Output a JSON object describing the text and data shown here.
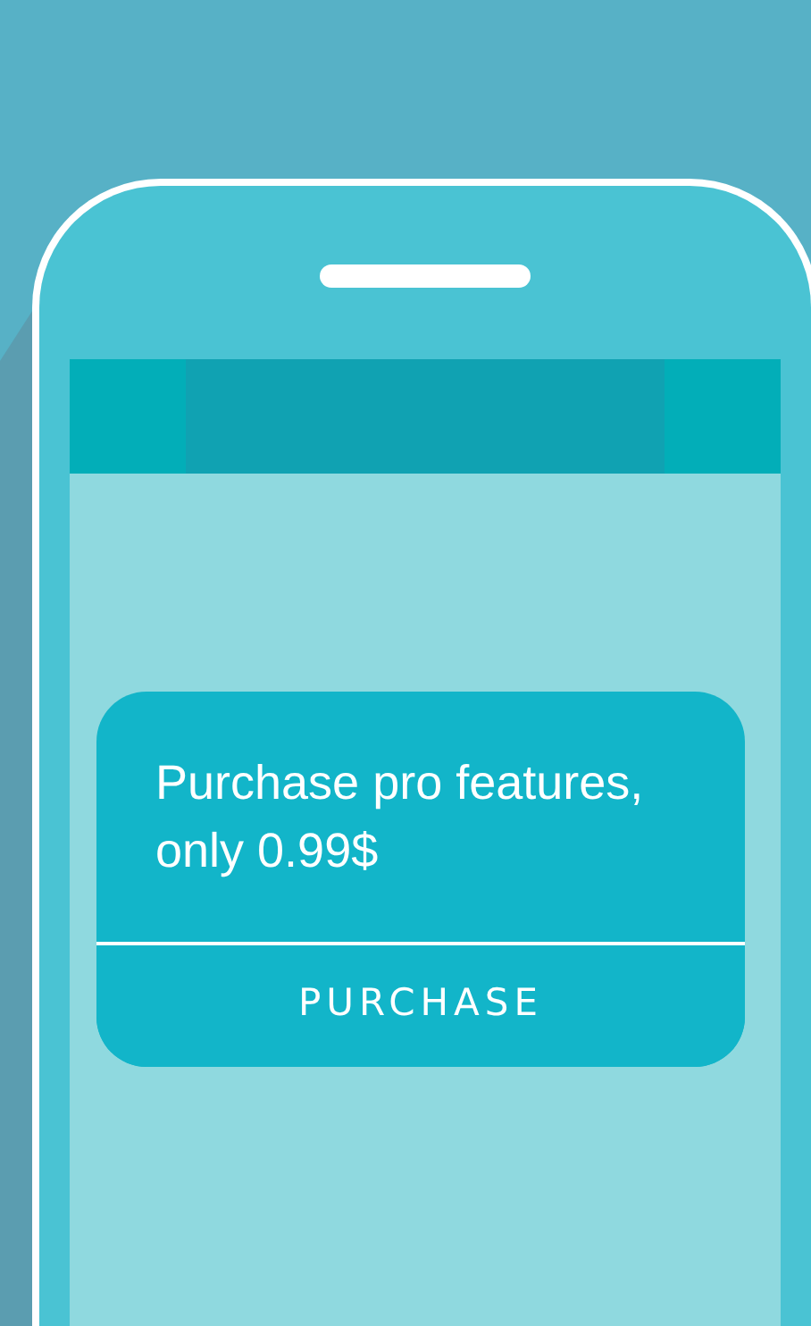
{
  "dialog": {
    "message": "Purchase pro features, only 0.99$",
    "button": "PURCHASE"
  }
}
